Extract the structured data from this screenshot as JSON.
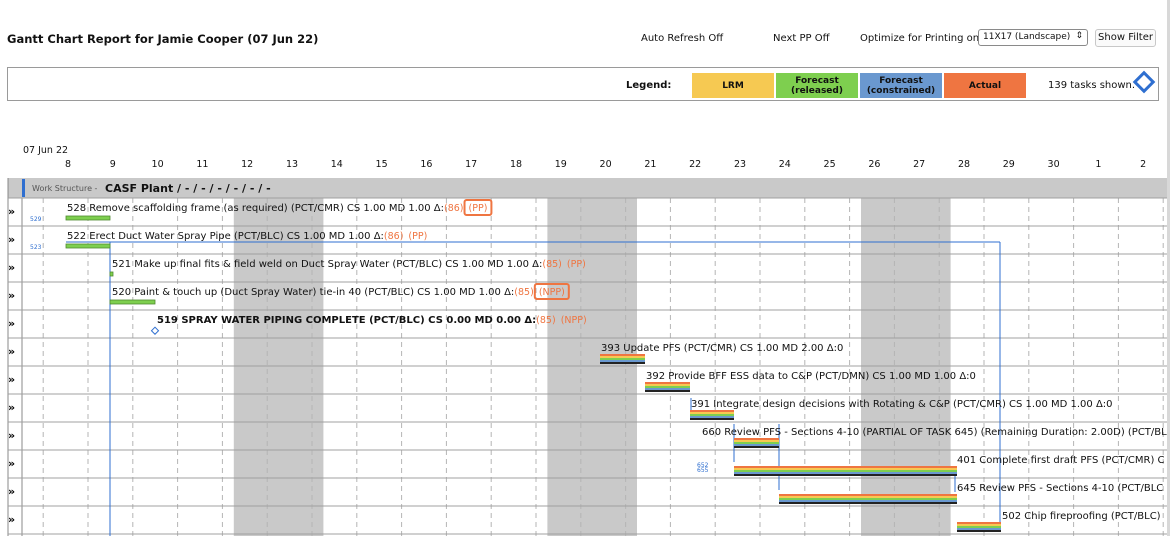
{
  "report": {
    "title": "Gantt Chart Report for Jamie Cooper (07 Jun 22)",
    "auto_refresh": "Auto Refresh Off",
    "next_pp": "Next PP Off",
    "optimize_label": "Optimize for Printing on:",
    "optimize_value": "11X17 (Landscape)",
    "show_filter": "Show Filter"
  },
  "legend": {
    "label": "Legend:",
    "items": [
      {
        "text": "LRM",
        "color": "#f6c952"
      },
      {
        "text": "Forecast\n(released)",
        "color": "#7ecf4f"
      },
      {
        "text": "Forecast\n(constrained)",
        "color": "#6a98cf"
      },
      {
        "text": "Actual",
        "color": "#ef7541"
      }
    ],
    "tasks_shown": "139 tasks shown."
  },
  "timeline": {
    "start_label": "07 Jun 22",
    "days": [
      "8",
      "9",
      "10",
      "11",
      "12",
      "13",
      "14",
      "15",
      "16",
      "17",
      "18",
      "19",
      "20",
      "21",
      "22",
      "23",
      "24",
      "25",
      "26",
      "27",
      "28",
      "29",
      "30",
      "1",
      "2"
    ]
  },
  "work_structure": {
    "label": "Work Structure -",
    "name": "CASF Plant / - / - / - / - / - / -"
  },
  "tasks": [
    {
      "id": "528",
      "side_id": "529",
      "name": "Remove scaffolding frame (as required) (PCT/CMR)",
      "cs": "CS 1.00",
      "md": "MD 1.00",
      "delta_label": "Δ:",
      "delta": "(86)",
      "flag": "(PP)",
      "flag_boxed": true,
      "bold": false
    },
    {
      "id": "522",
      "side_id": "523",
      "name": "Erect Duct Water Spray Pipe (PCT/BLC)",
      "cs": "CS 1.00",
      "md": "MD 1.00",
      "delta_label": "Δ:",
      "delta": "(86)",
      "flag": "(PP)",
      "flag_boxed": false,
      "bold": false
    },
    {
      "id": "521",
      "side_id": "",
      "name": "Make up final fits & field weld on Duct Spray Water (PCT/BLC)",
      "cs": "CS 1.00",
      "md": "MD 1.00",
      "delta_label": "Δ:",
      "delta": "(85)",
      "flag": "(PP)",
      "flag_boxed": false,
      "bold": false
    },
    {
      "id": "520",
      "side_id": "",
      "name": "Paint & touch up (Duct Spray Water) tie-in 40 (PCT/BLC)",
      "cs": "CS 1.00",
      "md": "MD 1.00",
      "delta_label": "Δ:",
      "delta": "(85)",
      "flag": "(NPP)",
      "flag_boxed": true,
      "bold": false
    },
    {
      "id": "519",
      "side_id": "",
      "name": "SPRAY WATER PIPING COMPLETE (PCT/BLC)",
      "cs": "CS 0.00",
      "md": "MD 0.00",
      "delta_label": "Δ:",
      "delta": "(85)",
      "flag": "(NPP)",
      "flag_boxed": false,
      "bold": true
    },
    {
      "id": "393",
      "side_id": "",
      "name": "Update PFS (PCT/CMR)",
      "cs": "CS 1.00",
      "md": "MD 2.00",
      "delta_label": "Δ:0",
      "delta": "",
      "flag": "",
      "flag_boxed": false,
      "bold": false
    },
    {
      "id": "392",
      "side_id": "",
      "name": "Provide BFF ESS data to C&P (PCT/DMN)",
      "cs": "CS 1.00",
      "md": "MD 1.00",
      "delta_label": "Δ:0",
      "delta": "",
      "flag": "",
      "flag_boxed": false,
      "bold": false
    },
    {
      "id": "391",
      "side_id": "",
      "name": "Integrate design decisions with Rotating & C&P (PCT/CMR)",
      "cs": "CS 1.00",
      "md": "MD 1.00",
      "delta_label": "Δ:0",
      "delta": "",
      "flag": "",
      "flag_boxed": false,
      "bold": false
    },
    {
      "id": "660",
      "side_id": "",
      "name": "Review PFS - Sections 4-10 (PARTIAL OF TASK 645) (Remaining Duration: 2.00D) (PCT/BL",
      "cs": "",
      "md": "",
      "delta_label": "",
      "delta": "",
      "flag": "",
      "flag_boxed": false,
      "bold": false
    },
    {
      "id": "401",
      "side_id": "652\n655",
      "name": "Complete first draft PFS (PCT/CMR)  C",
      "cs": "",
      "md": "",
      "delta_label": "",
      "delta": "",
      "flag": "",
      "flag_boxed": false,
      "bold": false
    },
    {
      "id": "645",
      "side_id": "",
      "name": "Review PFS - Sections 4-10 (PCT/BLC",
      "cs": "",
      "md": "",
      "delta_label": "",
      "delta": "",
      "flag": "",
      "flag_boxed": false,
      "bold": false
    },
    {
      "id": "502",
      "side_id": "",
      "name": "Chip fireproofing (PCT/BLC)",
      "cs": "",
      "md": "",
      "delta_label": "",
      "delta": "",
      "flag": "",
      "flag_boxed": false,
      "bold": false
    }
  ],
  "colors": {
    "accent_orange": "#ef7541",
    "link_blue": "#2f6fd0",
    "weekend_gray": "#c9c9c9",
    "grid": "#b5b5b5"
  }
}
